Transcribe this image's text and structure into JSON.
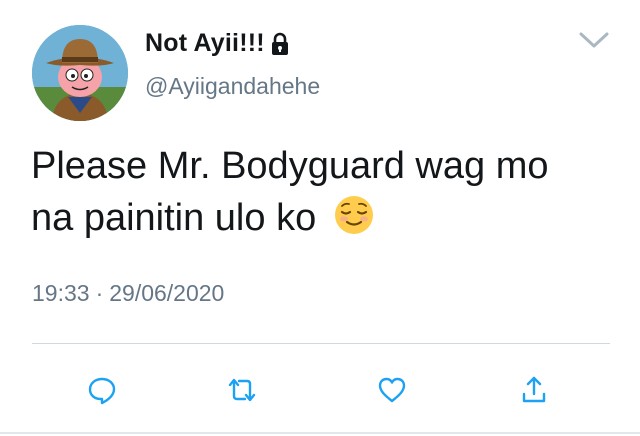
{
  "user": {
    "display_name": "Not Ayii!!!",
    "handle": "@Ayiigandahehe",
    "avatar_icon": "cartoon-cowboy-avatar",
    "protected_icon": "lock-icon"
  },
  "tweet": {
    "text_line1": "Please Mr. Bodyguard wag mo",
    "text_line2": "na painitin ulo ko",
    "emoji": "relieved-face-emoji",
    "time": "19:33",
    "separator": "·",
    "date": "29/06/2020"
  },
  "actions": {
    "reply_icon": "reply-icon",
    "retweet_icon": "retweet-icon",
    "like_icon": "heart-icon",
    "share_icon": "share-icon"
  },
  "colors": {
    "text": "#14171a",
    "secondary": "#657786",
    "divider": "#cfd9de",
    "action_icon": "#1da1f2"
  }
}
